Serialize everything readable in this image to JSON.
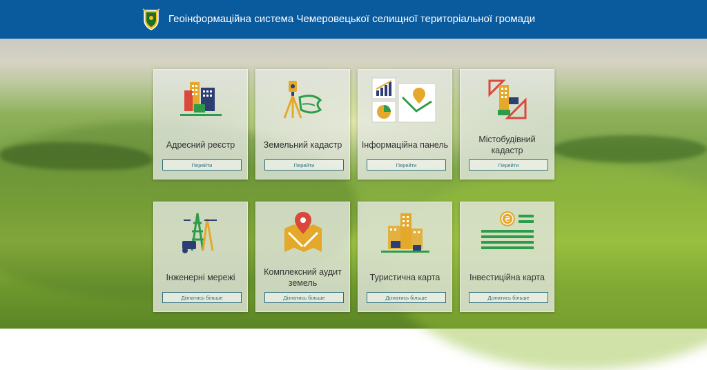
{
  "header": {
    "title": "Геоінформаційна система Чемеровецької селищної територіальної громади",
    "background": "#0a5a9e"
  },
  "cards": [
    {
      "label": "Адресний реєстр",
      "button": "Перейти",
      "icon": "building-icon"
    },
    {
      "label": "Земельний кадастр",
      "button": "Перейти",
      "icon": "surveyor-theodolite-icon"
    },
    {
      "label": "Інформаційна панель",
      "button": "Перейти",
      "icon": "dashboard-charts-icon"
    },
    {
      "label": "Містобудівний кадастр",
      "button": "Перейти",
      "icon": "urban-planning-icon"
    },
    {
      "label": "Інженерні мережі",
      "button": "Дізнатись більше",
      "icon": "power-tower-icon"
    },
    {
      "label": "Комплексний аудит земель",
      "button": "Дізнатись більше",
      "icon": "map-pin-icon"
    },
    {
      "label": "Туристична карта",
      "button": "Дізнатись більше",
      "icon": "tourist-city-icon"
    },
    {
      "label": "Інвестиційна карта",
      "button": "Дізнатись більше",
      "icon": "investment-coins-icon"
    }
  ],
  "colors": {
    "accent_green": "#2e9b4a",
    "accent_gold": "#e4a92a",
    "accent_red": "#d9483b",
    "accent_navy": "#2d3e72"
  }
}
